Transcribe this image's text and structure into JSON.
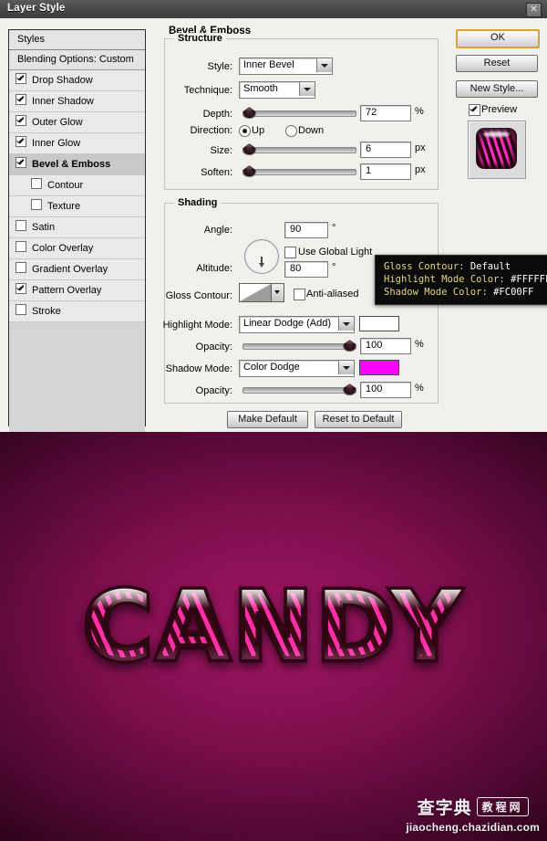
{
  "window": {
    "title": "Layer Style",
    "close_label": "✕"
  },
  "styles_panel": {
    "header": "Styles",
    "blending_options": "Blending Options: Custom",
    "effects": [
      {
        "label": "Drop Shadow",
        "checked": true,
        "sub": false,
        "selected": false
      },
      {
        "label": "Inner Shadow",
        "checked": true,
        "sub": false,
        "selected": false
      },
      {
        "label": "Outer Glow",
        "checked": true,
        "sub": false,
        "selected": false
      },
      {
        "label": "Inner Glow",
        "checked": true,
        "sub": false,
        "selected": false
      },
      {
        "label": "Bevel & Emboss",
        "checked": true,
        "sub": false,
        "selected": true
      },
      {
        "label": "Contour",
        "checked": false,
        "sub": true,
        "selected": false
      },
      {
        "label": "Texture",
        "checked": false,
        "sub": true,
        "selected": false
      },
      {
        "label": "Satin",
        "checked": false,
        "sub": false,
        "selected": false
      },
      {
        "label": "Color Overlay",
        "checked": false,
        "sub": false,
        "selected": false
      },
      {
        "label": "Gradient Overlay",
        "checked": false,
        "sub": false,
        "selected": false
      },
      {
        "label": "Pattern Overlay",
        "checked": true,
        "sub": false,
        "selected": false
      },
      {
        "label": "Stroke",
        "checked": false,
        "sub": false,
        "selected": false
      }
    ]
  },
  "panel": {
    "title": "Bevel & Emboss",
    "structure": {
      "title": "Structure",
      "style_label": "Style:",
      "style_value": "Inner Bevel",
      "technique_label": "Technique:",
      "technique_value": "Smooth",
      "depth_label": "Depth:",
      "depth_value": "72",
      "depth_unit": "%",
      "direction_label": "Direction:",
      "direction_up": "Up",
      "direction_down": "Down",
      "direction_selected": "Up",
      "size_label": "Size:",
      "size_value": "6",
      "size_unit": "px",
      "soften_label": "Soften:",
      "soften_value": "1",
      "soften_unit": "px"
    },
    "shading": {
      "title": "Shading",
      "angle_label": "Angle:",
      "angle_value": "90",
      "angle_unit": "°",
      "use_global_light_label": "Use Global Light",
      "use_global_light_checked": false,
      "altitude_label": "Altitude:",
      "altitude_value": "80",
      "altitude_unit": "°",
      "gloss_contour_label": "Gloss Contour:",
      "anti_aliased_label": "Anti-aliased",
      "anti_aliased_checked": false,
      "highlight_mode_label": "Highlight Mode:",
      "highlight_mode_value": "Linear Dodge (Add)",
      "highlight_color": "#FFFFFF",
      "highlight_opacity_label": "Opacity:",
      "highlight_opacity_value": "100",
      "highlight_opacity_unit": "%",
      "shadow_mode_label": "Shadow Mode:",
      "shadow_mode_value": "Color Dodge",
      "shadow_color": "#FC00FF",
      "shadow_opacity_label": "Opacity:",
      "shadow_opacity_value": "100",
      "shadow_opacity_unit": "%"
    },
    "make_default": "Make Default",
    "reset_to_default": "Reset to Default"
  },
  "actions": {
    "ok": "OK",
    "reset": "Reset",
    "new_style": "New Style...",
    "preview_label": "Preview",
    "preview_checked": true
  },
  "callout": {
    "line1_label": "Gloss Contour: ",
    "line1_value": "Default",
    "line2_label": "Highlight Mode Color: ",
    "line2_value": "#FFFFFF",
    "line3_label": "Shadow Mode Color: ",
    "line3_value": "#FC00FF"
  },
  "artwork": {
    "text": "CANDY"
  },
  "watermark": {
    "brand": "查字典",
    "tag": "教程网",
    "url": "jiaocheng.chazidian.com"
  }
}
